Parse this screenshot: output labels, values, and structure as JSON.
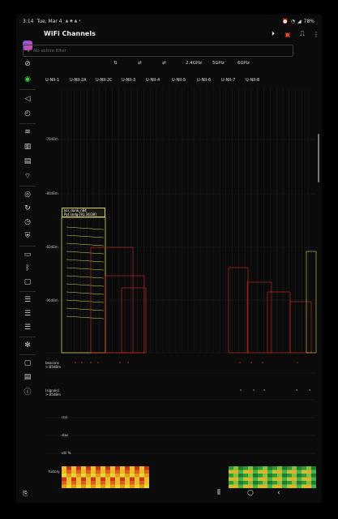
{
  "status_bar": {
    "time": "3:14",
    "date": "Tue, Mar 4",
    "battery": "78%"
  },
  "app": {
    "title": "WiFi Channels",
    "filter_placeholder": "No active filter"
  },
  "toolbar": {
    "play_icon": "play-circle-icon",
    "pdf_icon": "pdf-icon",
    "signal_icon": "signal-step-icon",
    "menu_icon": "more-vert-icon"
  },
  "band_buttons": [
    "2.4GHz",
    "5GHz",
    "6GHz"
  ],
  "unii_bands": [
    "U-NII-1",
    "U-NII-2A",
    "U-NII-2C",
    "U-NII-3",
    "U-NII-4",
    "U-NII-5",
    "U-NII-6",
    "U-NII-7",
    "U-NII-8"
  ],
  "y_labels": [
    "-70dBm",
    "-80dBm",
    "-90dBm",
    "-60dBm"
  ],
  "y_labels_ordered": [
    "-70dBm",
    "-80dBm",
    "-60dBm",
    "-90dBm"
  ],
  "ssid_box": {
    "line1": "kor_dunk_n84",
    "line2": "Pyt sndg-[91.34/38]"
  },
  "metric_labels": {
    "beacons": "beacons\n>-85dBm",
    "signals": "(signals)\n>-85dBm",
    "rssi": "rssi",
    "stas": "stas",
    "util": "util %",
    "history": "history"
  },
  "colors": {
    "background": "#0b0b0b",
    "accent_green": "#3ecf4a",
    "red_network": "#d62a1e",
    "yellow_network": "#d7d35a",
    "grid": "#2a2a2a"
  },
  "sidebar_icons": [
    "app-logo-icon",
    "no-wifi-icon",
    "shield-green-icon",
    "send-icon",
    "speed-icon",
    "wifi-icon",
    "bar-chart-icon",
    "bar-chart-2-icon",
    "signal-icon",
    "radar-icon",
    "refresh-icon",
    "history-icon",
    "shield-icon",
    "router-icon",
    "bluetooth-icon",
    "monitor-icon",
    "server-icon",
    "server-2-icon",
    "server-3-icon",
    "settings-icon",
    "chat-icon",
    "document-icon",
    "info-icon"
  ],
  "navbar_icons": [
    "recents-icon",
    "home-icon",
    "back-icon",
    "screenshot-icon"
  ]
}
